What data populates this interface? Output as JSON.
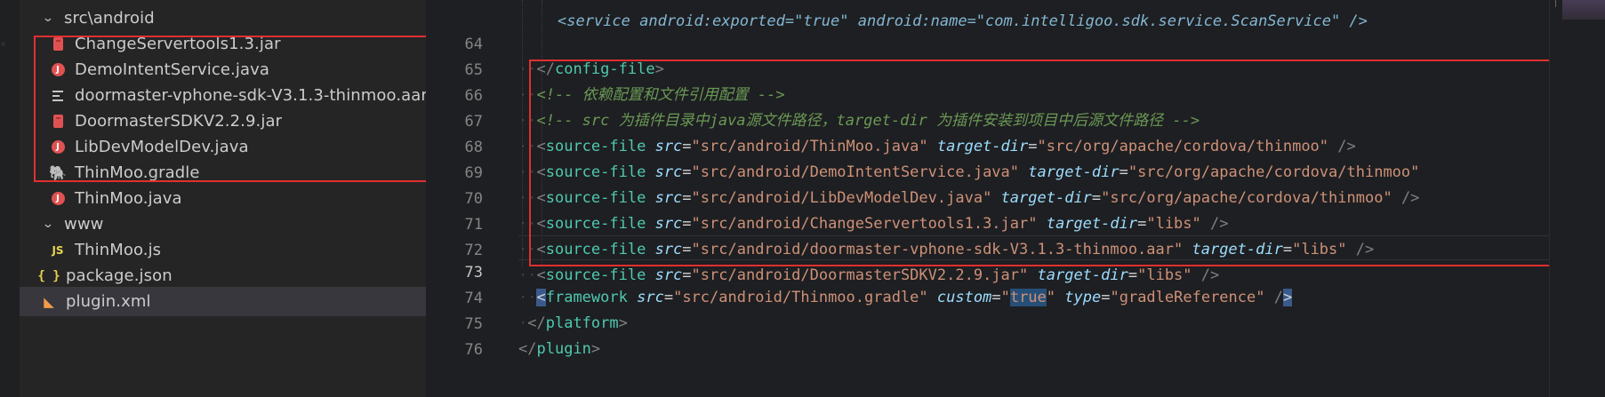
{
  "explorer": {
    "folder_android": "src\\android",
    "files": [
      {
        "label": "ChangeServertools1.3.jar",
        "icon": "jar-icon"
      },
      {
        "label": "DemoIntentService.java",
        "icon": "java-icon"
      },
      {
        "label": "doormaster-vphone-sdk-V3.1.3-thinmoo.aar",
        "icon": "file-lines-icon"
      },
      {
        "label": "DoormasterSDKV2.2.9.jar",
        "icon": "jar-icon"
      },
      {
        "label": "LibDevModelDev.java",
        "icon": "java-icon"
      },
      {
        "label": "ThinMoo.gradle",
        "icon": "gradle-elephant-icon"
      },
      {
        "label": "ThinMoo.java",
        "icon": "java-icon"
      }
    ],
    "folder_www": "www",
    "www_files": [
      {
        "label": "ThinMoo.js",
        "icon_text": "JS"
      }
    ],
    "root_files": [
      {
        "label": "package.json",
        "icon_text": "{ }"
      },
      {
        "label": "plugin.xml",
        "icon": "rss-icon"
      }
    ]
  },
  "editor": {
    "line_numbers": [
      "64",
      "65",
      "66",
      "67",
      "68",
      "69",
      "70",
      "71",
      "72",
      "73",
      "74",
      "75",
      "76"
    ],
    "current_line": "73",
    "l63_partial": "<service android:exported=\"true\" android:name=\"com.intelligoo.sdk.service.ScanService\" />",
    "l64_tag": "config-file",
    "l65_comment": "<!-- 依赖配置和文件引用配置 -->",
    "l66_comment": "<!-- src 为插件目录中java源文件路径，target-dir 为插件安装到项目中后源文件路径 -->",
    "tag_source_file": "source-file",
    "attr_src": "src",
    "attr_target_dir": "target-dir",
    "l67_src": "\"src/android/ThinMoo.java\"",
    "l67_target": "\"src/org/apache/cordova/thinmoo\"",
    "l68_src": "\"src/android/DemoIntentService.java\"",
    "l68_target": "\"src/org/apache/cordova/thinmoo\"",
    "l69_src": "\"src/android/LibDevModelDev.java\"",
    "l69_target": "\"src/org/apache/cordova/thinmoo\"",
    "l70_src": "\"src/android/ChangeServertools1.3.jar\"",
    "l70_target": "\"libs\"",
    "l71_src": "\"src/android/doormaster-vphone-sdk-V3.1.3-thinmoo.aar\"",
    "l71_target": "\"libs\"",
    "l72_src": "\"src/android/DoormasterSDKV2.2.9.jar\"",
    "l72_target": "\"libs\"",
    "l73_tag": "framework",
    "l73_src": "\"src/android/Thinmoo.gradle\"",
    "l73_attr_custom": "custom",
    "l73_custom_q1": "\"",
    "l73_custom_val": "true",
    "l73_custom_q2": "\"",
    "l73_attr_type": "type",
    "l73_type": "\"gradleReference\"",
    "l74_tag": "platform",
    "l75_tag": "plugin"
  },
  "colors": {
    "highlight_box": "#e0302e",
    "tag": "#4ec9b0",
    "attribute": "#9cdcfe",
    "string": "#ce9178",
    "comment": "#6a9955"
  }
}
